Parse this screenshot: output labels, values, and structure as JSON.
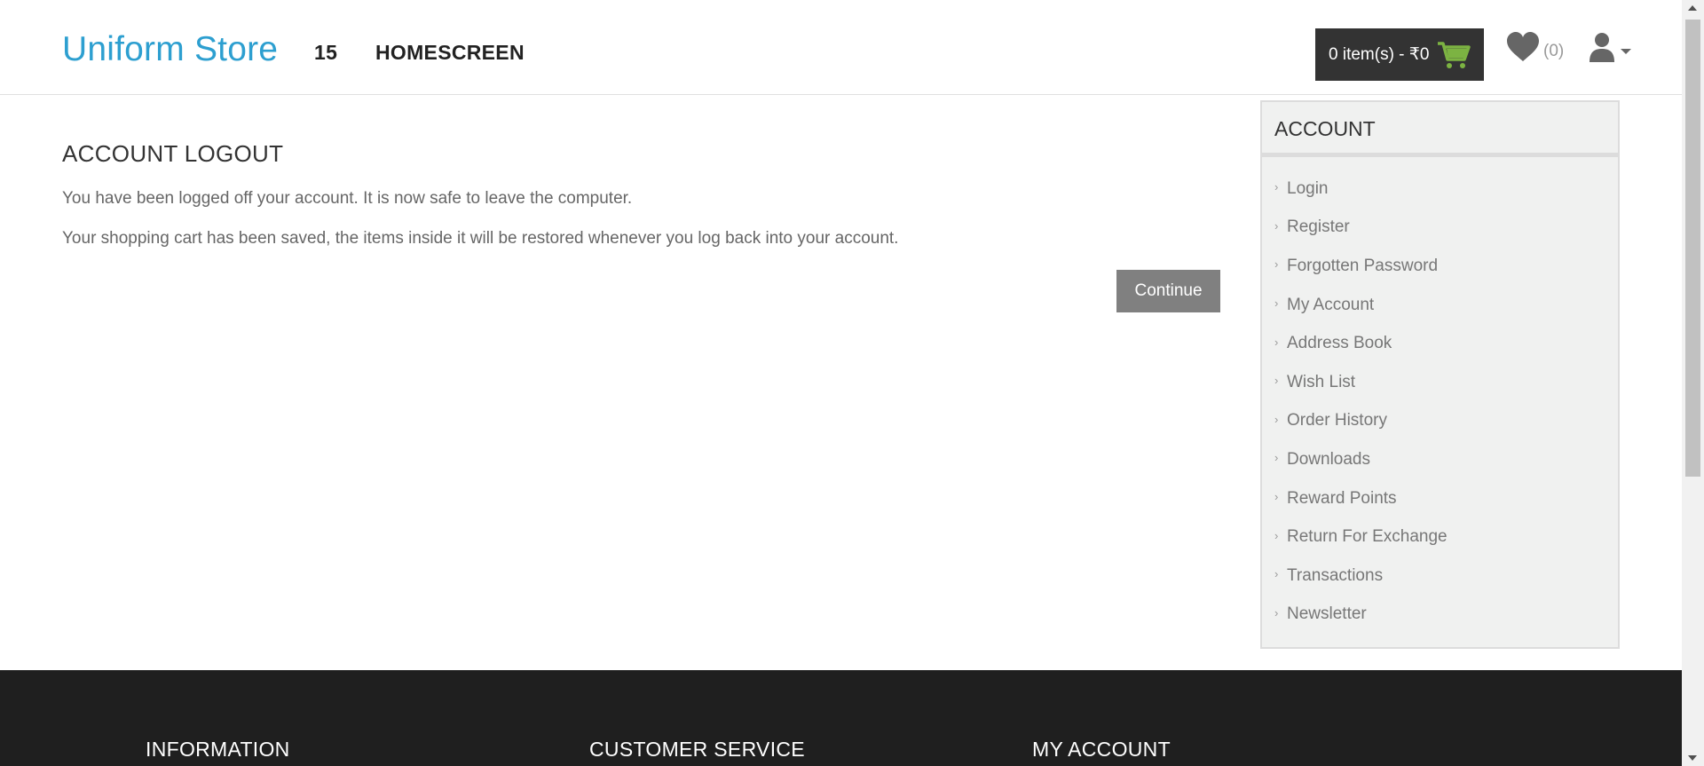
{
  "header": {
    "logo": "Uniform Store",
    "nav": [
      "15",
      "HOMESCREEN"
    ],
    "cart_label": "0 item(s) - ₹0",
    "wishlist_count": "(0)",
    "icons": {
      "cart": "cart-icon",
      "wishlist": "heart-icon",
      "user": "user-icon"
    },
    "accent_color": "#2d9fd0",
    "cart_icon_color": "#7cb342"
  },
  "main": {
    "title": "ACCOUNT LOGOUT",
    "message_1": "You have been logged off your account. It is now safe to leave the computer.",
    "message_2": "Your shopping cart has been saved, the items inside it will be restored whenever you log back into your account.",
    "continue_label": "Continue"
  },
  "sidebar": {
    "title": "ACCOUNT",
    "items": [
      {
        "label": "Login"
      },
      {
        "label": "Register"
      },
      {
        "label": "Forgotten Password"
      },
      {
        "label": "My Account"
      },
      {
        "label": "Address Book"
      },
      {
        "label": "Wish List"
      },
      {
        "label": "Order History"
      },
      {
        "label": "Downloads"
      },
      {
        "label": "Reward Points"
      },
      {
        "label": "Return For Exchange"
      },
      {
        "label": "Transactions"
      },
      {
        "label": "Newsletter"
      }
    ]
  },
  "footer": {
    "headings": [
      "INFORMATION",
      "CUSTOMER SERVICE",
      "MY ACCOUNT"
    ]
  }
}
